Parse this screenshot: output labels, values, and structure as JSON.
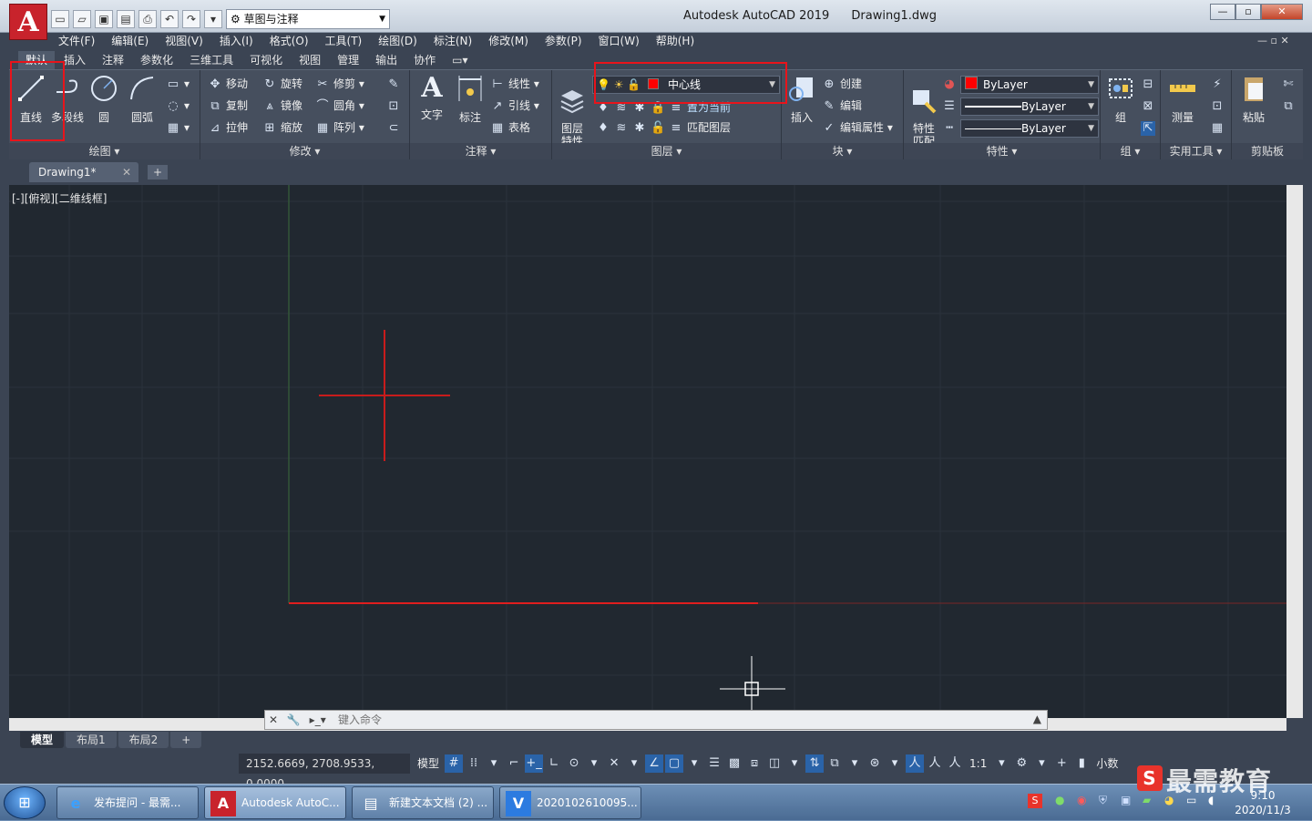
{
  "titlebar": {
    "app_name": "Autodesk AutoCAD 2019",
    "document": "Drawing1.dwg",
    "workspace": "草图与注释",
    "logo": "A"
  },
  "menu": [
    "文件(F)",
    "编辑(E)",
    "视图(V)",
    "插入(I)",
    "格式(O)",
    "工具(T)",
    "绘图(D)",
    "标注(N)",
    "修改(M)",
    "参数(P)",
    "窗口(W)",
    "帮助(H)"
  ],
  "ribbon_tabs": [
    "默认",
    "插入",
    "注释",
    "参数化",
    "三维工具",
    "可视化",
    "视图",
    "管理",
    "输出",
    "协作"
  ],
  "panels": {
    "draw": {
      "title": "绘图",
      "line": "直线",
      "polyline": "多段线",
      "circle": "圆",
      "arc": "圆弧"
    },
    "modify": {
      "title": "修改",
      "move": "移动",
      "rotate": "旋转",
      "trim": "修剪",
      "copy": "复制",
      "mirror": "镜像",
      "fillet": "圆角",
      "stretch": "拉伸",
      "scale": "缩放",
      "array": "阵列"
    },
    "annotation": {
      "title": "注释",
      "text": "文字",
      "dimension": "标注",
      "linear": "线性",
      "leader": "引线",
      "table": "表格"
    },
    "layers": {
      "title": "图层",
      "layer_props": "图层\n特性",
      "layer_name": "中心线",
      "set_current": "置为当前",
      "match_layer": "匹配图层"
    },
    "block": {
      "title": "块",
      "insert": "插入",
      "create": "创建",
      "edit": "编辑",
      "edit_attr": "编辑属性"
    },
    "properties": {
      "title": "特性",
      "match": "特性\n匹配",
      "color": "ByLayer",
      "linetype": "ByLayer",
      "lineweight": "ByLayer"
    },
    "groups": {
      "title": "组",
      "group": "组"
    },
    "utilities": {
      "title": "实用工具",
      "measure": "测量"
    },
    "clipboard": {
      "title": "剪贴板",
      "paste": "粘贴"
    }
  },
  "file_tab": "Drawing1*",
  "view_label": "[-][俯视][二维线框]",
  "command": {
    "placeholder": "键入命令"
  },
  "layout_tabs": [
    "模型",
    "布局1",
    "布局2"
  ],
  "status": {
    "coords": "2152.6669, 2708.9533, 0.0000",
    "model": "模型",
    "scale": "1:1",
    "units": "小数"
  },
  "taskbar": {
    "items": [
      "发布提问 - 最需...",
      "Autodesk AutoC...",
      "新建文本文档 (2) ...",
      "2020102610095..."
    ],
    "time": "9:10",
    "date": "2020/11/3"
  },
  "watermark": "最需教育",
  "colors": {
    "red_line": "#e01e1e",
    "canvas": "#212830",
    "highlight": "#e8141b"
  }
}
